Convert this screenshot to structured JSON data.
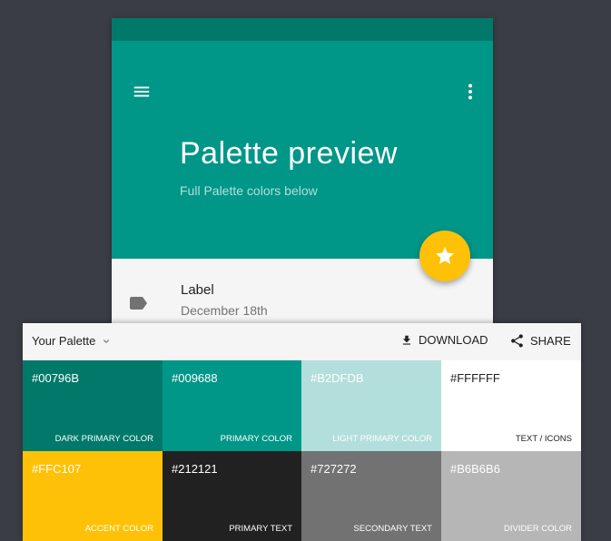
{
  "preview": {
    "title": "Palette preview",
    "subtitle": "Full Palette colors below",
    "list_item": {
      "title": "Label",
      "subtitle": "December 18th"
    },
    "icons": {
      "menu": "menu-icon",
      "more": "more-vert-icon",
      "fab": "star-icon",
      "label": "label-icon"
    }
  },
  "palette_bar": {
    "palette_label": "Your Palette",
    "download_label": "DOWNLOAD",
    "share_label": "SHARE"
  },
  "swatches": [
    {
      "hex": "#00796B",
      "name": "DARK PRIMARY COLOR",
      "bg": "#00796b",
      "hex_color": "#ffffff",
      "name_color": "#ffffff"
    },
    {
      "hex": "#009688",
      "name": "PRIMARY COLOR",
      "bg": "#009688",
      "hex_color": "#ffffff",
      "name_color": "#ffffff"
    },
    {
      "hex": "#B2DFDB",
      "name": "LIGHT PRIMARY COLOR",
      "bg": "#b2dfdb",
      "hex_color": "#ffffff",
      "name_color": "#ffffff"
    },
    {
      "hex": "#FFFFFF",
      "name": "TEXT / ICONS",
      "bg": "#ffffff",
      "hex_color": "#212121",
      "name_color": "#212121"
    },
    {
      "hex": "#FFC107",
      "name": "ACCENT COLOR",
      "bg": "#ffc107",
      "hex_color": "#ffffff",
      "name_color": "#ffffff"
    },
    {
      "hex": "#212121",
      "name": "PRIMARY TEXT",
      "bg": "#212121",
      "hex_color": "#ffffff",
      "name_color": "#ffffff"
    },
    {
      "hex": "#727272",
      "name": "SECONDARY TEXT",
      "bg": "#727272",
      "hex_color": "#ffffff",
      "name_color": "#ffffff"
    },
    {
      "hex": "#B6B6B6",
      "name": "DIVIDER COLOR",
      "bg": "#b6b6b6",
      "hex_color": "#ffffff",
      "name_color": "#ffffff"
    }
  ]
}
